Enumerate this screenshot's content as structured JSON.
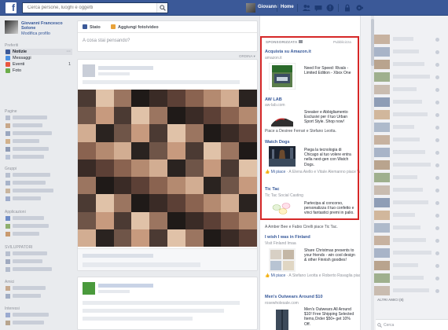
{
  "topbar": {
    "logo": "f",
    "search_placeholder": "Cerca persone, luoghi e oggetti",
    "user_name": "Giovanni",
    "home_label": "Home"
  },
  "left": {
    "profile_name": "Giovanni Francesco Solone",
    "edit_profile": "Modifica profilo",
    "favorites_title": "Preferiti",
    "nav": [
      {
        "label": "Notizie",
        "color": "#3b5998"
      },
      {
        "label": "Messaggi",
        "color": "#4a90e2"
      },
      {
        "label": "Eventi",
        "color": "#e9573f",
        "count": "1"
      },
      {
        "label": "Foto",
        "color": "#6cad4a"
      }
    ],
    "pages_title": "Pagine",
    "groups_title": "Gruppi",
    "apps_title": "Applicazioni",
    "dev_title": "SVILUPPATORI",
    "friends_title": "Amici",
    "interests_title": "Interessi"
  },
  "composer": {
    "tab_status": "Stato",
    "tab_photo": "Aggiungi foto/video",
    "placeholder": "A cosa stai pensando?"
  },
  "feed": {
    "sort_label": "ORDINA"
  },
  "ads": {
    "header": "SPONSORIZZATA",
    "create": "Pubblicizza",
    "items": [
      {
        "title": "Acquista su Amazon.it",
        "url": "amazon.it",
        "body": "Need For Speed: Rivals - Limited Edition - Xbox One"
      },
      {
        "title": "AW LAB",
        "url": "aw-lab.com",
        "body": "Sneaker e Abbigliamento Esclusivi per il tuo Urban Sport Style. Shop now!",
        "social": "Piace a Desiree Ferrari e Stefano Leotta."
      },
      {
        "title": "Watch Dogs",
        "body": "Piega la tecnologia di Chicago al tuo volere entra nella next-gen con Watch Dogs.",
        "like": "Mi piace",
        "social": "· A Elena Aiello e Vitale Alemanno piace Watch Dogs."
      },
      {
        "title": "Tic Tac",
        "url": "Tic Tac Social Casting",
        "body": "Partecipa al concorso, personalizza il tuo confetto e vinci fantastici premi in palio.",
        "social": "A Amber Bee e Fabio Cirelli piace Tic Tac."
      },
      {
        "title": "I wish I was in Finland",
        "url": "Visit Finland Imaa",
        "body": "Share Christmas presents to your friends - win cool design & other Finnish goodies!",
        "like": "Mi piace",
        "social": "· A Stefano Leotta e Roberto Ravaglia piace I wish I was in Finland."
      },
      {
        "title": "Men's Outwears Around $10",
        "url": "rosewholesale.com",
        "body": "Men's Outwears All Around $10! Free Shipping Selected Items,Order $50+ get 10% Off."
      }
    ]
  },
  "chat": {
    "others_label": "ALTRI AMICI (8)",
    "search_label": "Cerca"
  }
}
